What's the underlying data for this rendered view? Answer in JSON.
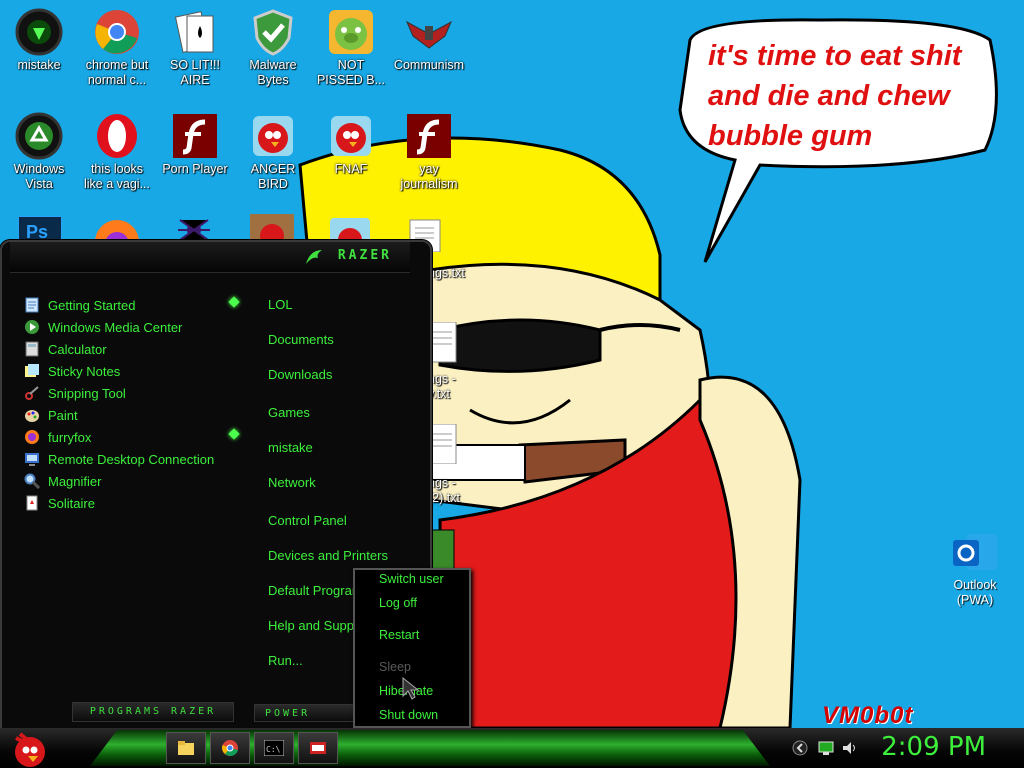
{
  "desktop": {
    "icons_row1": [
      {
        "label": "mistake"
      },
      {
        "label": "chrome but\nnormal c..."
      },
      {
        "label": "SO LIT!!!\nAIRE"
      },
      {
        "label": "Malware\nBytes"
      },
      {
        "label": "NOT\nPISSED B..."
      },
      {
        "label": "Communism"
      }
    ],
    "icons_row2": [
      {
        "label": "Windows\nVista"
      },
      {
        "label": "this looks\nlike a vagi..."
      },
      {
        "label": "Porn Player"
      },
      {
        "label": "ANGER\nBIRD"
      },
      {
        "label": "FNAF"
      },
      {
        "label": "yay\njournalism"
      }
    ],
    "partial_labels": [
      "ngs.txt",
      "ngs -\ny.txt",
      "ngs -\n(2).txt"
    ],
    "outlook_label": "Outlook\n(PWA)",
    "speech_text": "it's time to eat shit and die and chew bubble gum",
    "signature": "VM0b0t"
  },
  "start_menu": {
    "brand": "RAZER",
    "programs": [
      {
        "label": "Getting Started",
        "icon": "getting-started-icon"
      },
      {
        "label": "Windows Media Center",
        "icon": "media-center-icon"
      },
      {
        "label": "Calculator",
        "icon": "calculator-icon"
      },
      {
        "label": "Sticky Notes",
        "icon": "sticky-notes-icon"
      },
      {
        "label": "Snipping Tool",
        "icon": "snipping-tool-icon"
      },
      {
        "label": "Paint",
        "icon": "paint-icon"
      },
      {
        "label": "furryfox",
        "icon": "firefox-icon"
      },
      {
        "label": "Remote Desktop Connection",
        "icon": "remote-desktop-icon"
      },
      {
        "label": "Magnifier",
        "icon": "magnifier-icon"
      },
      {
        "label": "Solitaire",
        "icon": "solitaire-icon"
      }
    ],
    "right_items": [
      {
        "label": "LOL"
      },
      {
        "label": "Documents"
      },
      {
        "label": "Downloads"
      },
      {
        "label": "Games"
      },
      {
        "label": "mistake"
      },
      {
        "label": "Network"
      },
      {
        "label": "Control Panel"
      },
      {
        "label": "Devices and Printers"
      },
      {
        "label": "Default Programs"
      },
      {
        "label": "Help and Support"
      },
      {
        "label": "Run..."
      }
    ],
    "programs_bar": "PROGRAMS RAZER",
    "power_bar": "POWER"
  },
  "power_menu": {
    "items": [
      {
        "label": "Switch user",
        "enabled": true
      },
      {
        "label": "Log off",
        "enabled": true
      },
      {
        "label": "Restart",
        "enabled": true
      },
      {
        "label": "Sleep",
        "enabled": false
      },
      {
        "label": "Hibernate",
        "enabled": true
      },
      {
        "label": "Shut down",
        "enabled": true
      }
    ]
  },
  "taskbar": {
    "pinned": [
      "explorer-icon",
      "chrome-icon",
      "cmd-icon",
      "media-icon"
    ],
    "clock": "2:09 PM",
    "accent": "#3cf03c"
  }
}
